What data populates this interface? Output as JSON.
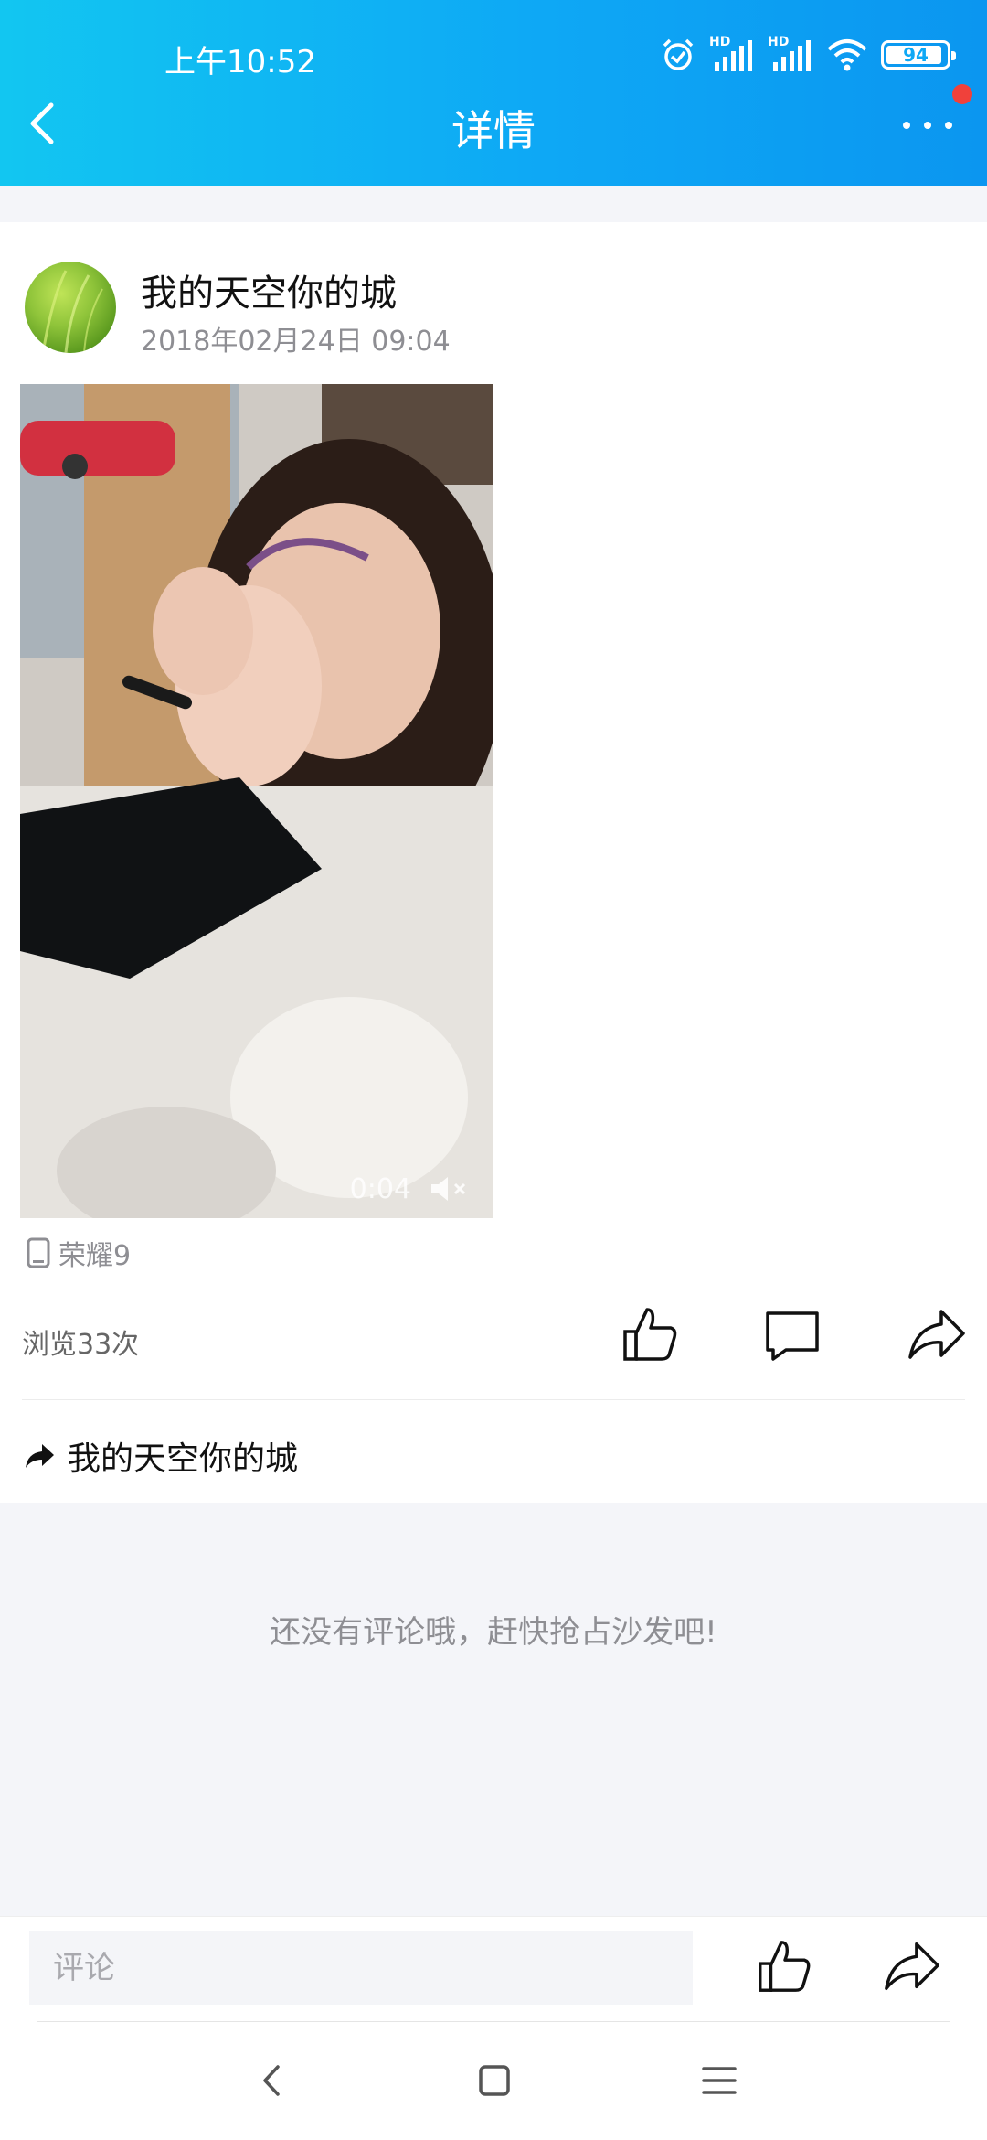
{
  "status_bar": {
    "time": "上午10:52",
    "hd1": "HD",
    "hd2": "HD",
    "battery_percent": 94,
    "battery_label": "94"
  },
  "header": {
    "title": "详情"
  },
  "post": {
    "author": "我的天空你的城",
    "time": "2018年02月24日 09:04",
    "video": {
      "duration": "0:04"
    },
    "device": "荣耀9",
    "views": "浏览33次",
    "forward_label": "我的天空你的城"
  },
  "comments": {
    "empty_message": "还没有评论哦，赶快抢占沙发吧!"
  },
  "bottom_bar": {
    "comment_placeholder": "评论"
  },
  "colors": {
    "header_gradient_start": "#12c6f1",
    "header_gradient_end": "#0b96f0",
    "notification_dot": "#f0413b",
    "background_band": "#f4f5f9"
  },
  "icons": {
    "back": "chevron-left-icon",
    "more": "more-dots-icon",
    "alarm": "alarm-icon",
    "signal": "signal-icon",
    "wifi": "wifi-icon",
    "battery": "battery-icon",
    "mute": "mute-icon",
    "device": "phone-device-icon",
    "like": "thumbs-up-icon",
    "comment": "comment-icon",
    "share": "share-icon",
    "forward": "forward-arrow-icon",
    "nav_back": "nav-back-icon",
    "nav_home": "nav-home-icon",
    "nav_menu": "nav-menu-icon"
  }
}
